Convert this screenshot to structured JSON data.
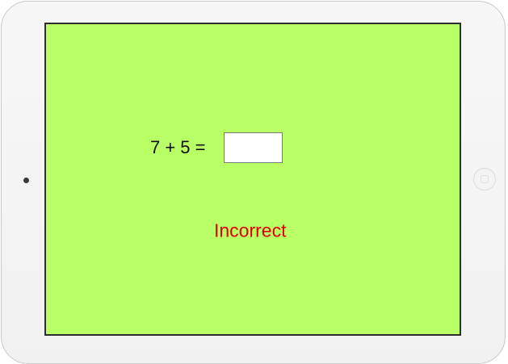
{
  "quiz": {
    "equation": "7 + 5 =",
    "answer_value": "",
    "feedback": "Incorrect"
  },
  "device": {
    "camera_icon": "camera-dot-icon",
    "home_icon": "home-button-icon"
  },
  "colors": {
    "screen_background": "#b9ff66",
    "feedback": "#e00000",
    "text": "#111111"
  }
}
